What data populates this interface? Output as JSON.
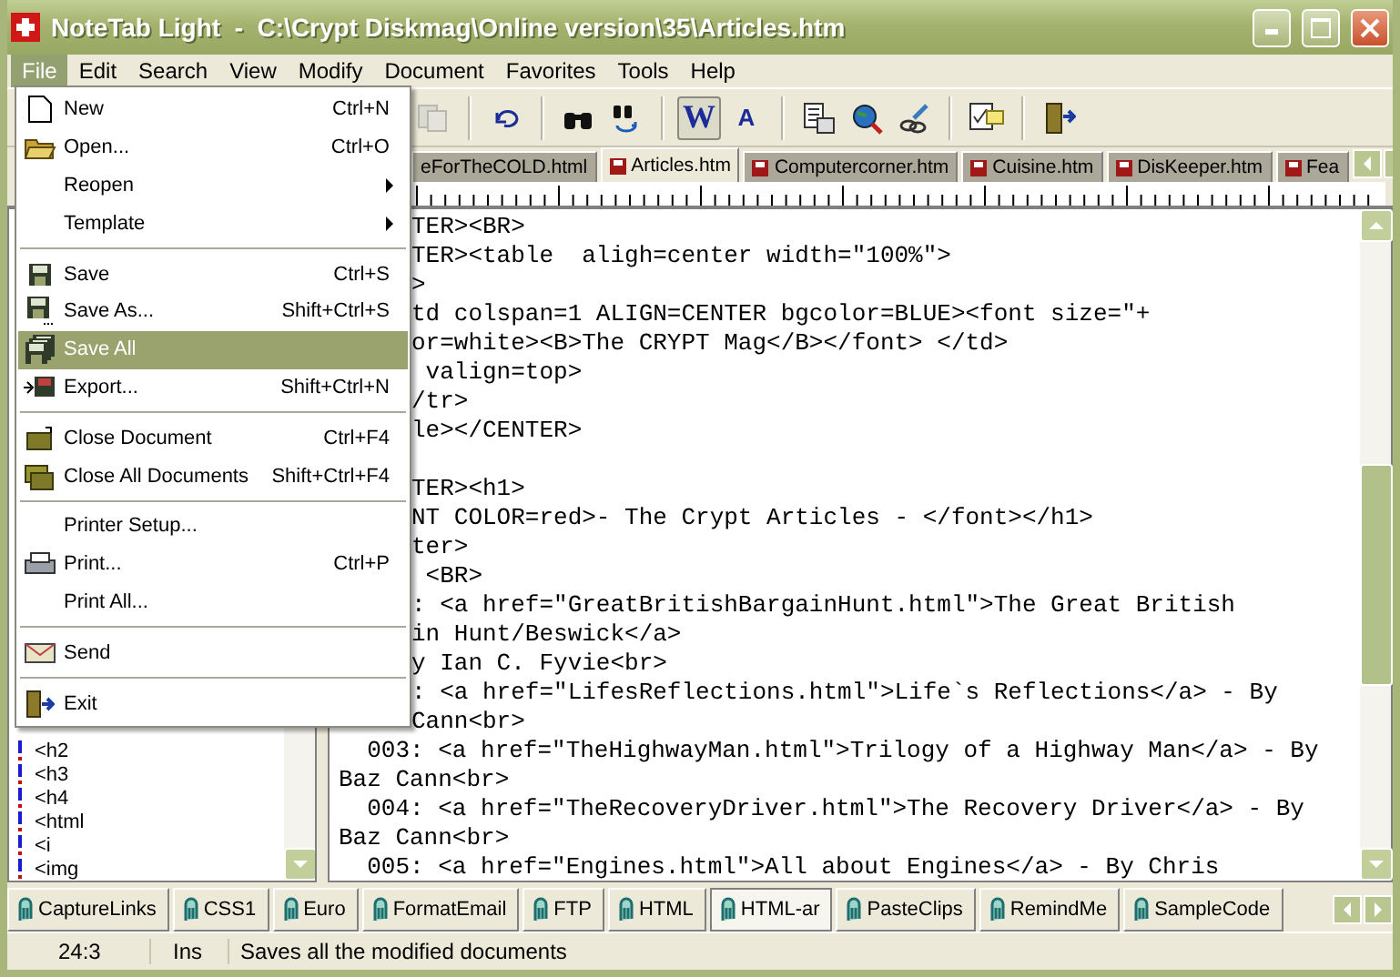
{
  "window": {
    "title": "NoteTab Light  -  C:\\Crypt Diskmag\\Online version\\35\\Articles.htm"
  },
  "menubar": [
    {
      "label": "File",
      "selected": true
    },
    {
      "label": "Edit",
      "selected": false
    },
    {
      "label": "Search",
      "selected": false
    },
    {
      "label": "View",
      "selected": false
    },
    {
      "label": "Modify",
      "selected": false
    },
    {
      "label": "Document",
      "selected": false
    },
    {
      "label": "Favorites",
      "selected": false
    },
    {
      "label": "Tools",
      "selected": false
    },
    {
      "label": "Help",
      "selected": false
    }
  ],
  "file_menu": [
    {
      "kind": "item",
      "label": "New",
      "shortcut": "Ctrl+N",
      "submenu": false,
      "selected": false
    },
    {
      "kind": "item",
      "label": "Open...",
      "shortcut": "Ctrl+O",
      "submenu": false,
      "selected": false
    },
    {
      "kind": "item",
      "label": "Reopen",
      "submenu": true,
      "selected": false
    },
    {
      "kind": "item",
      "label": "Template",
      "submenu": true,
      "selected": false
    },
    {
      "kind": "separator"
    },
    {
      "kind": "item",
      "label": "Save",
      "shortcut": "Ctrl+S",
      "submenu": false,
      "selected": false
    },
    {
      "kind": "item",
      "label": "Save As...",
      "shortcut": "Shift+Ctrl+S",
      "submenu": false,
      "selected": false
    },
    {
      "kind": "item",
      "label": "Save All",
      "submenu": false,
      "selected": true
    },
    {
      "kind": "item",
      "label": "Export...",
      "shortcut": "Shift+Ctrl+N",
      "submenu": false,
      "selected": false
    },
    {
      "kind": "separator"
    },
    {
      "kind": "item",
      "label": "Close Document",
      "shortcut": "Ctrl+F4",
      "submenu": false,
      "selected": false
    },
    {
      "kind": "item",
      "label": "Close All Documents",
      "shortcut": "Shift+Ctrl+F4",
      "submenu": false,
      "selected": false
    },
    {
      "kind": "separator"
    },
    {
      "kind": "item",
      "label": "Printer Setup...",
      "submenu": false,
      "selected": false
    },
    {
      "kind": "item",
      "label": "Print...",
      "shortcut": "Ctrl+P",
      "submenu": false,
      "selected": false
    },
    {
      "kind": "item",
      "label": "Print All...",
      "submenu": false,
      "selected": false
    },
    {
      "kind": "separator"
    },
    {
      "kind": "item",
      "label": "Send",
      "submenu": false,
      "selected": false
    },
    {
      "kind": "separator"
    },
    {
      "kind": "item",
      "label": "Exit",
      "submenu": false,
      "selected": false
    }
  ],
  "toolbar": {
    "word_wrap": {
      "glyph": "W",
      "pressed": true
    },
    "text_format": {
      "glyph": "A",
      "pressed": false
    }
  },
  "doc_tabs": [
    {
      "label": "eForTheCOLD.html",
      "selected": false
    },
    {
      "label": "Articles.htm",
      "selected": true
    },
    {
      "label": "Computercorner.htm",
      "selected": false
    },
    {
      "label": "Cuisine.htm",
      "selected": false
    },
    {
      "label": "DisKeeper.htm",
      "selected": false
    },
    {
      "label": "Fea",
      "selected": false
    }
  ],
  "editor": {
    "lines": [
      {
        "kind": "covered",
        "text": "TER><BR>"
      },
      {
        "kind": "covered",
        "text": "TER><table  aligh=center width=\"100%\">"
      },
      {
        "kind": "covered",
        "text": ">"
      },
      {
        "kind": "covered",
        "text": "td colspan=1 ALIGN=CENTER bgcolor=BLUE><font size=\"+"
      },
      {
        "kind": "covered",
        "text": "or=white><B>The CRYPT Mag</B></font> </td>"
      },
      {
        "kind": "covered",
        "text": " valign=top>"
      },
      {
        "kind": "covered",
        "text": "/tr>"
      },
      {
        "kind": "covered",
        "text": "le></CENTER>"
      },
      {
        "kind": "blank"
      },
      {
        "kind": "covered",
        "text": "TER><h1>"
      },
      {
        "kind": "covered",
        "text": "NT COLOR=red>- The Crypt Articles - </font></h1>"
      },
      {
        "kind": "covered",
        "text": "ter>"
      },
      {
        "kind": "covered",
        "text": " <BR>"
      },
      {
        "kind": "covered",
        "text": ": <a href=\"GreatBritishBargainHunt.html\">The Great British"
      },
      {
        "kind": "covered",
        "text": "in Hunt/Beswick</a>"
      },
      {
        "kind": "covered",
        "text": "y Ian C. Fyvie<br>"
      },
      {
        "kind": "covered",
        "text": ": <a href=\"LifesReflections.html\">Life`s Reflections</a> - By"
      },
      {
        "kind": "covered",
        "text": "Cann<br>"
      },
      {
        "kind": "full",
        "text": "  003: <a href=\"TheHighwayMan.html\">Trilogy of a Highway Man</a> - By"
      },
      {
        "kind": "full",
        "text": "Baz Cann<br>"
      },
      {
        "kind": "full",
        "text": "  004: <a href=\"TheRecoveryDriver.html\">The Recovery Driver</a> - By"
      },
      {
        "kind": "full",
        "text": "Baz Cann<br>"
      },
      {
        "kind": "full",
        "text": "  005: <a href=\"Engines.html\">All about Engines</a> - By Chris"
      }
    ]
  },
  "clip_panel": {
    "items": [
      "<h2",
      "<h3",
      "<h4",
      "<html",
      "<i",
      "<img"
    ]
  },
  "clip_tabs": [
    {
      "label": "CaptureLinks",
      "selected": false
    },
    {
      "label": "CSS1",
      "selected": false
    },
    {
      "label": "Euro",
      "selected": false
    },
    {
      "label": "FormatEmail",
      "selected": false
    },
    {
      "label": "FTP",
      "selected": false
    },
    {
      "label": "HTML",
      "selected": false
    },
    {
      "label": "HTML-ar",
      "selected": true
    },
    {
      "label": "PasteClips",
      "selected": false
    },
    {
      "label": "RemindMe",
      "selected": false
    },
    {
      "label": "SampleCode",
      "selected": false
    }
  ],
  "status_bar": {
    "position": "24:3",
    "mode": "Ins",
    "message": "Saves all the modified documents"
  }
}
